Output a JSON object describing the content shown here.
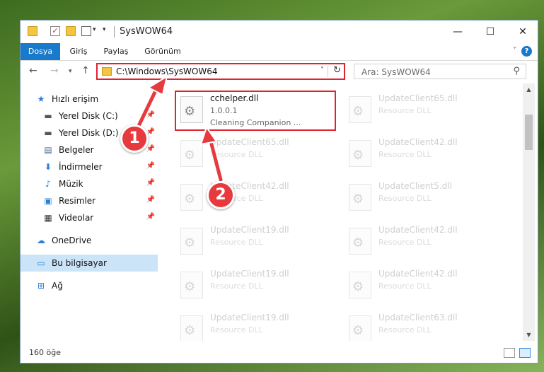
{
  "window": {
    "title": "SysWOW64",
    "controls": {
      "minimize": "—",
      "maximize": "☐",
      "close": "✕"
    }
  },
  "ribbon": {
    "tabs": [
      "Dosya",
      "Giriş",
      "Paylaş",
      "Görünüm"
    ],
    "help": "?"
  },
  "navbar": {
    "address": "C:\\Windows\\SysWOW64",
    "search_placeholder": "Ara: SysWOW64"
  },
  "sidebar": {
    "quick_access": "Hızlı erişim",
    "items": [
      "Yerel Disk (C:)",
      "Yerel Disk (D:)",
      "Belgeler",
      "İndirmeler",
      "Müzik",
      "Resimler",
      "Videolar"
    ],
    "onedrive": "OneDrive",
    "this_pc": "Bu bilgisayar",
    "network": "Ağ"
  },
  "files": {
    "highlighted": {
      "name": "cchelper.dll",
      "version": "1.0.0.1",
      "description": "Cleaning Companion ..."
    },
    "left_column": [
      {
        "name": "UpdateClient65.dll",
        "type": "Resource DLL"
      },
      {
        "name": "UpdateClient42.dll",
        "type": "Resource DLL"
      },
      {
        "name": "UpdateClient19.dll",
        "type": "Resource DLL"
      },
      {
        "name": "UpdateClient19.dll",
        "type": "Resource DLL"
      },
      {
        "name": "UpdateClient19.dll",
        "type": "Resource DLL"
      }
    ],
    "right_column": [
      {
        "name": "UpdateClient65.dll",
        "type": "Resource DLL"
      },
      {
        "name": "UpdateClient42.dll",
        "type": "Resource DLL"
      },
      {
        "name": "UpdateClient5.dll",
        "type": "Resource DLL"
      },
      {
        "name": "UpdateClient42.dll",
        "type": "Resource DLL"
      },
      {
        "name": "UpdateClient42.dll",
        "type": "Resource DLL"
      },
      {
        "name": "UpdateClient63.dll",
        "type": "Resource DLL"
      }
    ]
  },
  "status": {
    "item_count": "160 öğe"
  },
  "annotations": {
    "step1": "1",
    "step2": "2"
  },
  "colors": {
    "accent": "#1979ca",
    "highlight": "#e0232e",
    "selected": "#cce4f7"
  }
}
